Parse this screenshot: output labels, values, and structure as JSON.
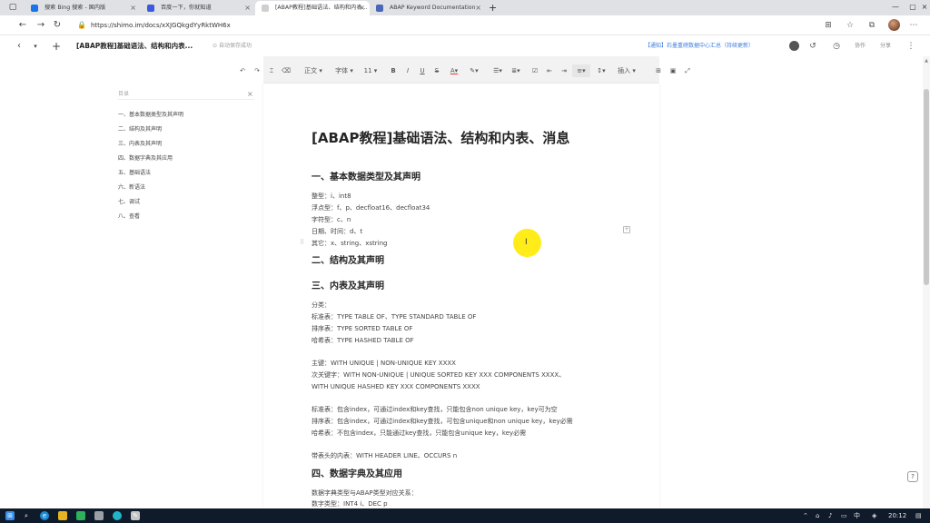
{
  "browser": {
    "tabs": [
      {
        "label": "搜索 Bing 搜索 - 国内版",
        "favicon_color": "#1a73e8"
      },
      {
        "label": "百度一下，你就知道",
        "favicon_color": "#3b5bdb"
      },
      {
        "label": "[ABAP教程]基础语法、结构和内表...",
        "favicon_color": "#cfcfcf"
      },
      {
        "label": "ABAP Keyword Documentation",
        "favicon_color": "#4a66b8"
      }
    ],
    "url": "https://shimo.im/docs/xXJGQkgdYyRktWH6x"
  },
  "doc_header": {
    "title": "[ABAP教程]基础语法、结构和内表...",
    "saved_status": "自动保存成功",
    "notice": "【通知】石墨重磅数据中心汇总（持续更新）",
    "collab_label": "协作",
    "share_label": "分享"
  },
  "toolbar": {
    "style_label": "正文",
    "font_label": "字体",
    "size_label": "11",
    "insert_label": "插入"
  },
  "toc": {
    "search_placeholder": "目录",
    "items": [
      "一、基本数据类型及其声明",
      "二、结构及其声明",
      "三、内表及其声明",
      "四、数据字典及其应用",
      "五、基础语法",
      "六、新语法",
      "七、调试",
      "八、查看"
    ]
  },
  "document": {
    "title": "[ABAP教程]基础语法、结构和内表、消息",
    "sections": {
      "s1": "一、基本数据类型及其声明",
      "s2": "二、结构及其声明",
      "s3": "三、内表及其声明",
      "s4": "四、数据字典及其应用"
    },
    "s1_lines": [
      "整型：i、int8",
      "浮点型：f、p、decfloat16、decfloat34",
      "字符型：c、n",
      "日期、时间：d、t",
      "其它：x、string、xstring"
    ],
    "s3_classify": "分类：",
    "s3_types": [
      "标准表：TYPE TABLE OF、TYPE STANDARD TABLE OF",
      "排序表：TYPE SORTED TABLE OF",
      "哈希表：TYPE HASHED TABLE OF"
    ],
    "s3_keys": [
      "主键：WITH UNIQUE | NON-UNIQUE KEY XXXX",
      "次关键字：WITH NON-UNIQUE | UNIQUE SORTED KEY XXX COMPONENTS XXXX、",
      "WITH UNIQUE HASHED KEY XXX COMPONENTS XXXX"
    ],
    "s3_desc": [
      "标准表：包含index，可通过index和key查找，只能包含non unique key，key可为空",
      "排序表：包含index，可通过index和key查找，可包含unique和non unique key，key必需",
      "哈希表：不包含index，只能通过key查找，只能包含unique key，key必需"
    ],
    "s3_header": "带表头的内表：WITH HEADER LINE、OCCURS n",
    "s4_lines": [
      "数据字典类型与ABAP类型对应关系：",
      "数字类型：INT4   i、DEC   p"
    ]
  },
  "taskbar": {
    "time": "20:12"
  },
  "colors": {
    "accent_link": "#3b7de0",
    "cursor_highlight": "#ffea00",
    "taskbar_bg": "#0f1a2a"
  }
}
